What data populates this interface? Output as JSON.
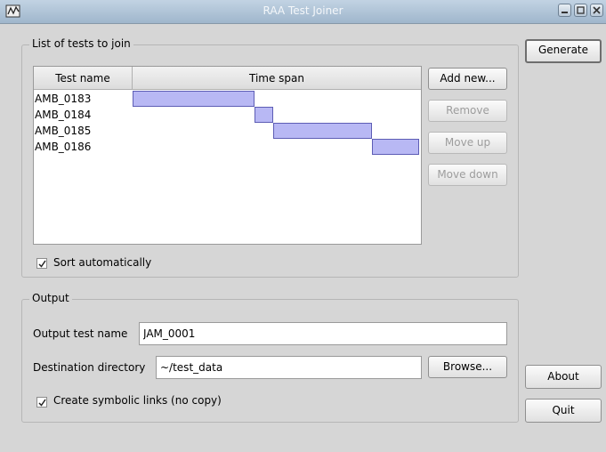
{
  "window": {
    "title": "RAA Test Joiner"
  },
  "tests_group": {
    "title": "List of tests to join",
    "columns": [
      "Test name",
      "Time span"
    ],
    "rows": [
      {
        "name": "AMB_0183",
        "span_start": 0.0,
        "span_end": 0.425
      },
      {
        "name": "AMB_0184",
        "span_start": 0.425,
        "span_end": 0.49
      },
      {
        "name": "AMB_0185",
        "span_start": 0.49,
        "span_end": 0.835
      },
      {
        "name": "AMB_0186",
        "span_start": 0.835,
        "span_end": 1.0
      }
    ],
    "buttons": {
      "add_new": "Add new...",
      "remove": "Remove",
      "move_up": "Move up",
      "move_down": "Move down"
    },
    "sort_automatically": {
      "label": "Sort automatically",
      "checked": true
    }
  },
  "output_group": {
    "title": "Output",
    "output_test_name_label": "Output test name",
    "output_test_name_value": "JAM_0001",
    "destination_label": "Destination directory",
    "destination_value": "~/test_data",
    "browse": "Browse...",
    "symlinks": {
      "label": "Create symbolic links (no copy)",
      "checked": true
    }
  },
  "side_buttons": {
    "generate": "Generate",
    "about": "About",
    "quit": "Quit"
  },
  "colors": {
    "bar_fill": "#b8b8f4",
    "bar_border": "#5d5db5",
    "titlebar": "#aebfd2"
  }
}
